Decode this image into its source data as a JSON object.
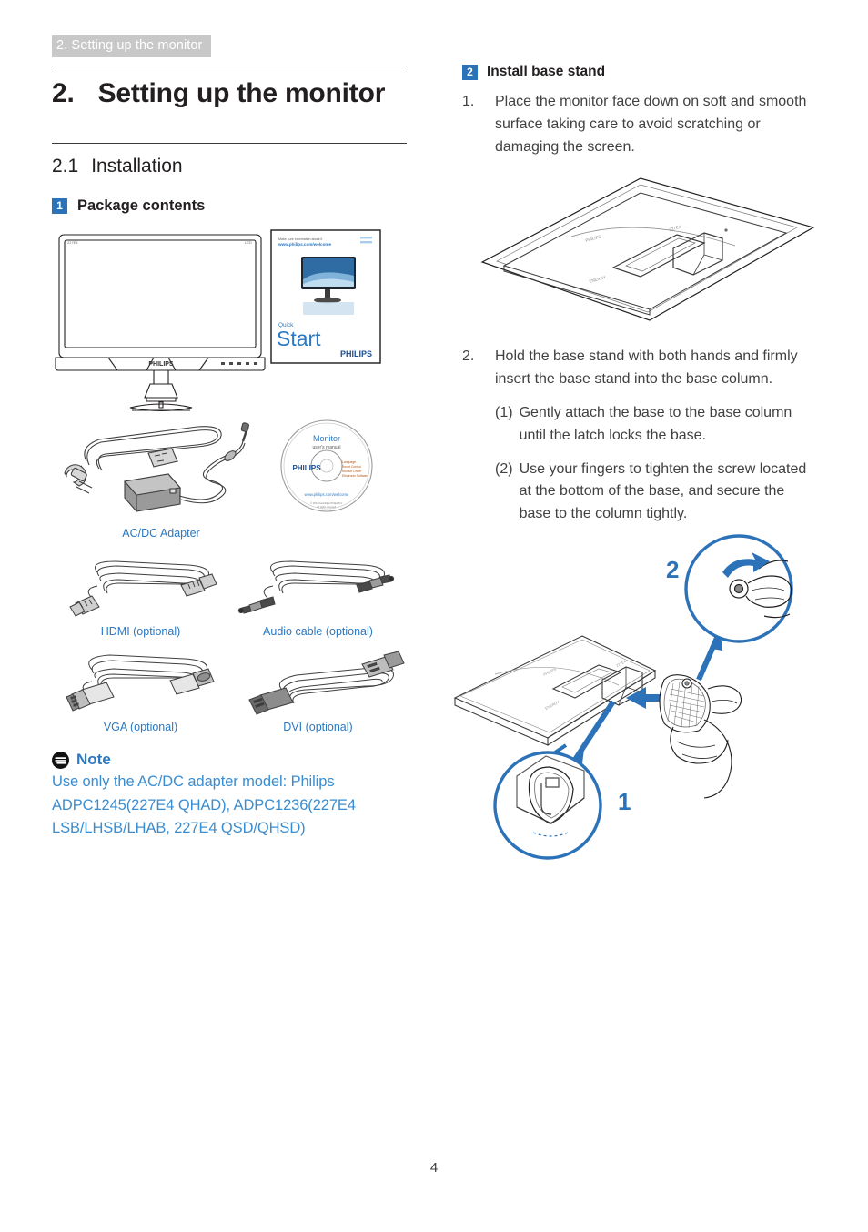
{
  "running_header": "2. Setting up the monitor",
  "chapter": {
    "number": "2.",
    "title": "Setting up the monitor"
  },
  "section": {
    "number": "2.1",
    "title": "Installation"
  },
  "left": {
    "subhead": {
      "badge": "1",
      "label": "Package contents"
    },
    "captions": {
      "adapter": "AC/DC Adapter",
      "hdmi": "HDMI (optional)",
      "audio": "Audio cable (optional)",
      "vga": "VGA (optional)",
      "dvi": "DVI (optional)"
    },
    "quick_start": {
      "url_line1": "Make sure information about it",
      "url_line2": "www.philips.com/welcome",
      "quick": "Quick",
      "start": "Start",
      "brand": "PHILIPS"
    },
    "cd": {
      "title": "Monitor",
      "subtitle": "user's manual",
      "brand": "PHILIPS",
      "side_text": "Language\nSmart Control\nMonitor Driver\nElectronic Software",
      "link": "www.philips.com/welcome"
    },
    "monitor_brand": "PHILIPS"
  },
  "note": {
    "title": "Note",
    "icon": "note-icon",
    "body": "Use only the AC/DC adapter model: Philips ADPC1245(227E4 QHAD), ADPC1236(227E4 LSB/LHSB/LHAB, 227E4 QSD/QHSD)"
  },
  "right": {
    "subhead": {
      "badge": "2",
      "label": "Install base stand"
    },
    "steps": [
      {
        "number": "1.",
        "text": "Place the monitor face down on soft and smooth surface taking care to avoid scratching or damaging the screen."
      },
      {
        "number": "2.",
        "text": "Hold the base stand with both hands and firmly insert the base stand into the base column."
      }
    ],
    "substeps": [
      {
        "number": "(1)",
        "text": "Gently attach the base to the base column until the latch locks the base."
      },
      {
        "number": "(2)",
        "text": "Use your fingers to tighten the screw located at the bottom of the base, and secure the base to the column tightly."
      }
    ],
    "callouts": {
      "one": "1",
      "two": "2"
    }
  },
  "page_number": "4",
  "colors": {
    "accent_blue": "#2b72b8",
    "caption_blue": "#2b79c2",
    "note_blue": "#3a8dd0",
    "header_band": "#c8c8c8",
    "line_art": "#231f20"
  }
}
